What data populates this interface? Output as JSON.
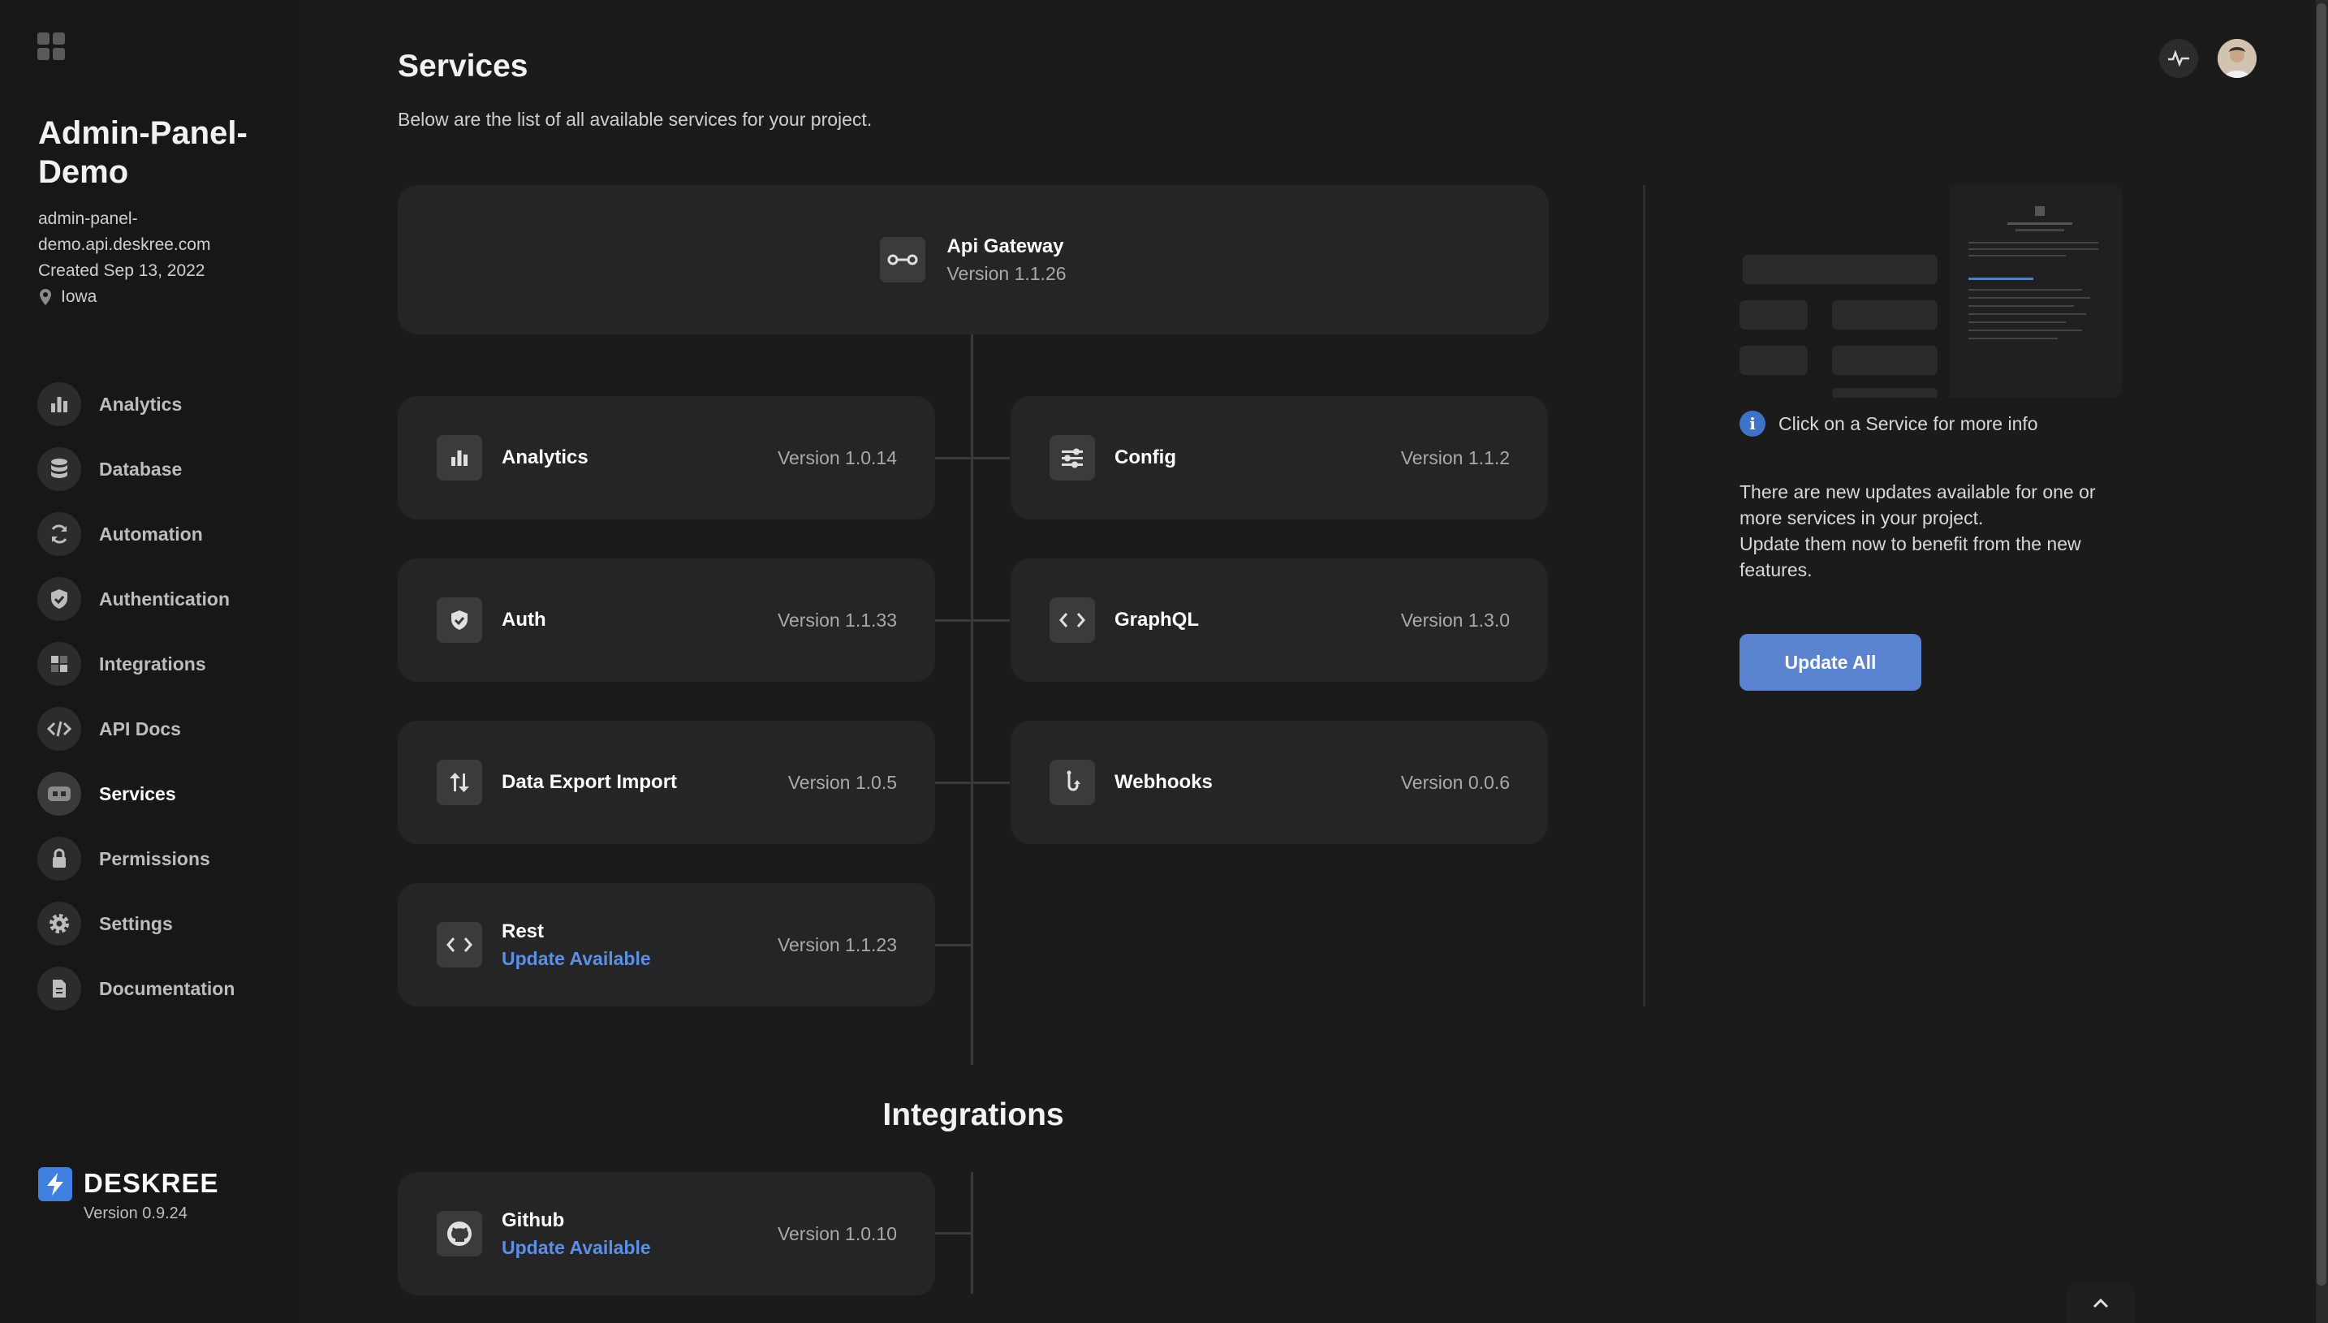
{
  "sidebar": {
    "project": {
      "name": "Admin-Panel-Demo",
      "domain": "admin-panel-demo.api.deskree.com",
      "created": "Created Sep 13, 2022",
      "location": "Iowa"
    },
    "nav": [
      {
        "label": "Analytics",
        "icon": "bar-chart-icon"
      },
      {
        "label": "Database",
        "icon": "database-icon"
      },
      {
        "label": "Automation",
        "icon": "refresh-icon"
      },
      {
        "label": "Authentication",
        "icon": "shield-icon"
      },
      {
        "label": "Integrations",
        "icon": "puzzle-icon"
      },
      {
        "label": "API Docs",
        "icon": "code-icon"
      },
      {
        "label": "Services",
        "icon": "services-icon"
      },
      {
        "label": "Permissions",
        "icon": "lock-icon"
      },
      {
        "label": "Settings",
        "icon": "gear-icon"
      },
      {
        "label": "Documentation",
        "icon": "document-icon"
      }
    ],
    "active_nav": "Services",
    "brand": {
      "name": "DESKREE",
      "version": "Version 0.9.24"
    }
  },
  "main": {
    "title": "Services",
    "subtitle": "Below are the list of all available services for your project.",
    "gateway": {
      "name": "Api Gateway",
      "version": "Version 1.1.26"
    },
    "services": [
      {
        "name": "Analytics",
        "version": "Version 1.0.14",
        "icon": "bar-chart-icon"
      },
      {
        "name": "Config",
        "version": "Version 1.1.2",
        "icon": "sliders-icon"
      },
      {
        "name": "Auth",
        "version": "Version 1.1.33",
        "icon": "shield-icon"
      },
      {
        "name": "GraphQL",
        "version": "Version 1.3.0",
        "icon": "code-icon"
      },
      {
        "name": "Data Export Import",
        "version": "Version 1.0.5",
        "icon": "transfer-icon"
      },
      {
        "name": "Webhooks",
        "version": "Version 0.0.6",
        "icon": "hook-icon"
      },
      {
        "name": "Rest",
        "version": "Version 1.1.23",
        "icon": "code-icon",
        "update": "Update Available"
      }
    ],
    "integrations_title": "Integrations",
    "integrations": [
      {
        "name": "Github",
        "version": "Version 1.0.10",
        "icon": "github-icon",
        "update": "Update Available"
      }
    ]
  },
  "panel": {
    "info": "Click on a Service for more info",
    "update_text_1": "There are new updates available for one or more services in your project.",
    "update_text_2": "Update them now to benefit from the new features.",
    "update_all": "Update All"
  },
  "colors": {
    "background": "#1b1b1c",
    "card": "#252527",
    "accent": "#5c8fe6",
    "button": "#5a82d0"
  }
}
